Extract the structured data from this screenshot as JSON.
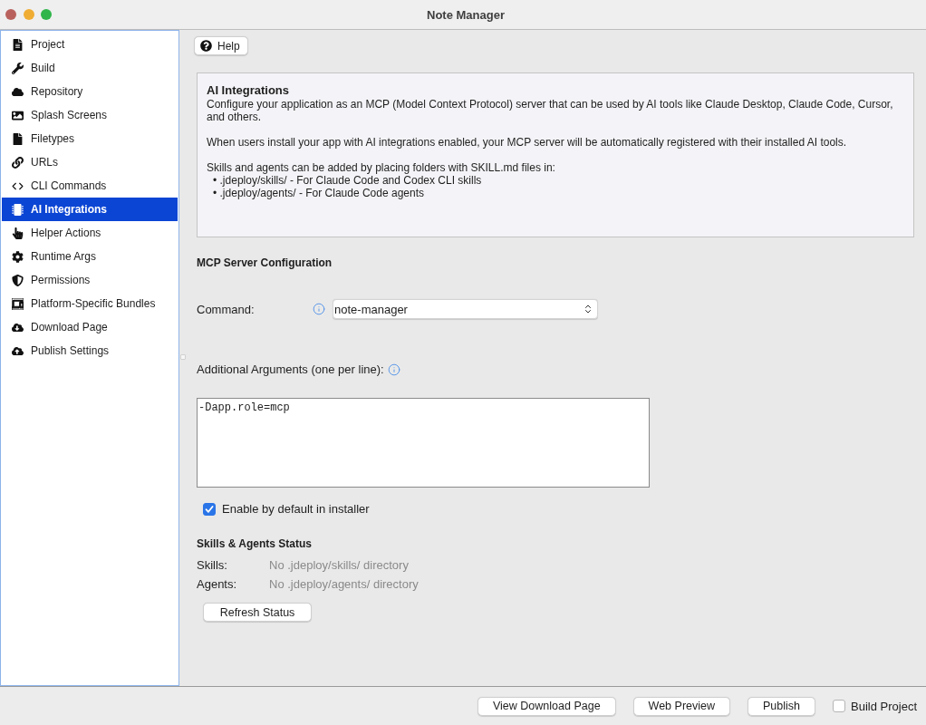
{
  "window": {
    "title": "Note Manager"
  },
  "sidebar": {
    "items": [
      {
        "label": "Project",
        "selected": false
      },
      {
        "label": "Build",
        "selected": false
      },
      {
        "label": "Repository",
        "selected": false
      },
      {
        "label": "Splash Screens",
        "selected": false
      },
      {
        "label": "Filetypes",
        "selected": false
      },
      {
        "label": "URLs",
        "selected": false
      },
      {
        "label": "CLI Commands",
        "selected": false
      },
      {
        "label": "AI Integrations",
        "selected": true
      },
      {
        "label": "Helper Actions",
        "selected": false
      },
      {
        "label": "Runtime Args",
        "selected": false
      },
      {
        "label": "Permissions",
        "selected": false
      },
      {
        "label": "Platform-Specific Bundles",
        "selected": false
      },
      {
        "label": "Download Page",
        "selected": false
      },
      {
        "label": "Publish Settings",
        "selected": false
      }
    ]
  },
  "help_button": {
    "label": "Help"
  },
  "info_panel": {
    "title": "AI Integrations",
    "paragraphs": [
      "Configure your application as an MCP (Model Context Protocol) server that can be used by AI tools like Claude Desktop, Claude Code, Cursor, and others.",
      "When users install your app with AI integrations enabled, your MCP server will be automatically registered with their installed AI tools.",
      "Skills and agents can be added by placing folders with SKILL.md files in:"
    ],
    "bullets": [
      "• .jdeploy/skills/ - For Claude Code and Codex CLI skills",
      "• .jdeploy/agents/ - For Claude Code agents"
    ]
  },
  "mcp_config": {
    "heading": "MCP Server Configuration",
    "command": {
      "label": "Command:",
      "value": "note-manager"
    },
    "arguments": {
      "label": "Additional Arguments (one per line):",
      "value": "-Dapp.role=mcp"
    },
    "enable_default": {
      "label": "Enable by default in installer",
      "checked": true
    }
  },
  "status": {
    "heading": "Skills & Agents Status",
    "rows": [
      {
        "label": "Skills:",
        "value": "No .jdeploy/skills/ directory"
      },
      {
        "label": "Agents:",
        "value": "No .jdeploy/agents/ directory"
      }
    ],
    "refresh_button": "Refresh Status"
  },
  "footer": {
    "buttons": [
      "View Download Page",
      "Web Preview",
      "Publish"
    ],
    "build_project": {
      "label": "Build Project",
      "checked": false
    }
  }
}
